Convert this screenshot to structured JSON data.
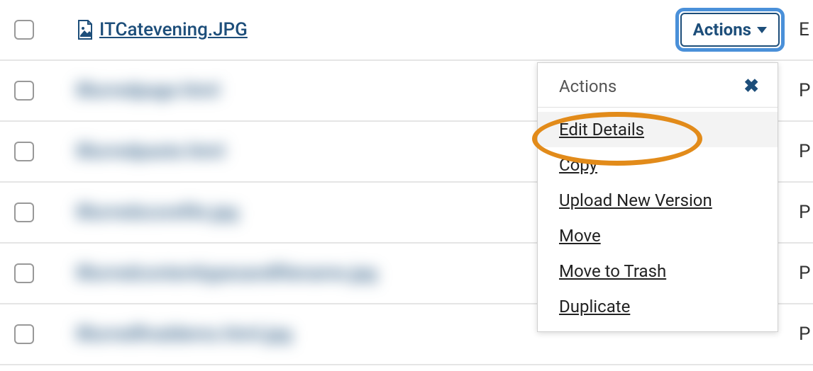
{
  "row1": {
    "filename": "ITCatevening.JPG",
    "status": "E",
    "actions_label": "Actions"
  },
  "row2": {
    "status": "P"
  },
  "row3": {
    "status": "P"
  },
  "row4": {
    "status": "P"
  },
  "row5": {
    "status": "P"
  },
  "row6": {
    "status": "P"
  },
  "dropdown": {
    "header": "Actions",
    "items": {
      "edit_details": "Edit Details",
      "copy": "Copy",
      "upload_new_version": "Upload New Version",
      "move": "Move",
      "move_to_trash": "Move to Trash",
      "duplicate": "Duplicate"
    }
  }
}
